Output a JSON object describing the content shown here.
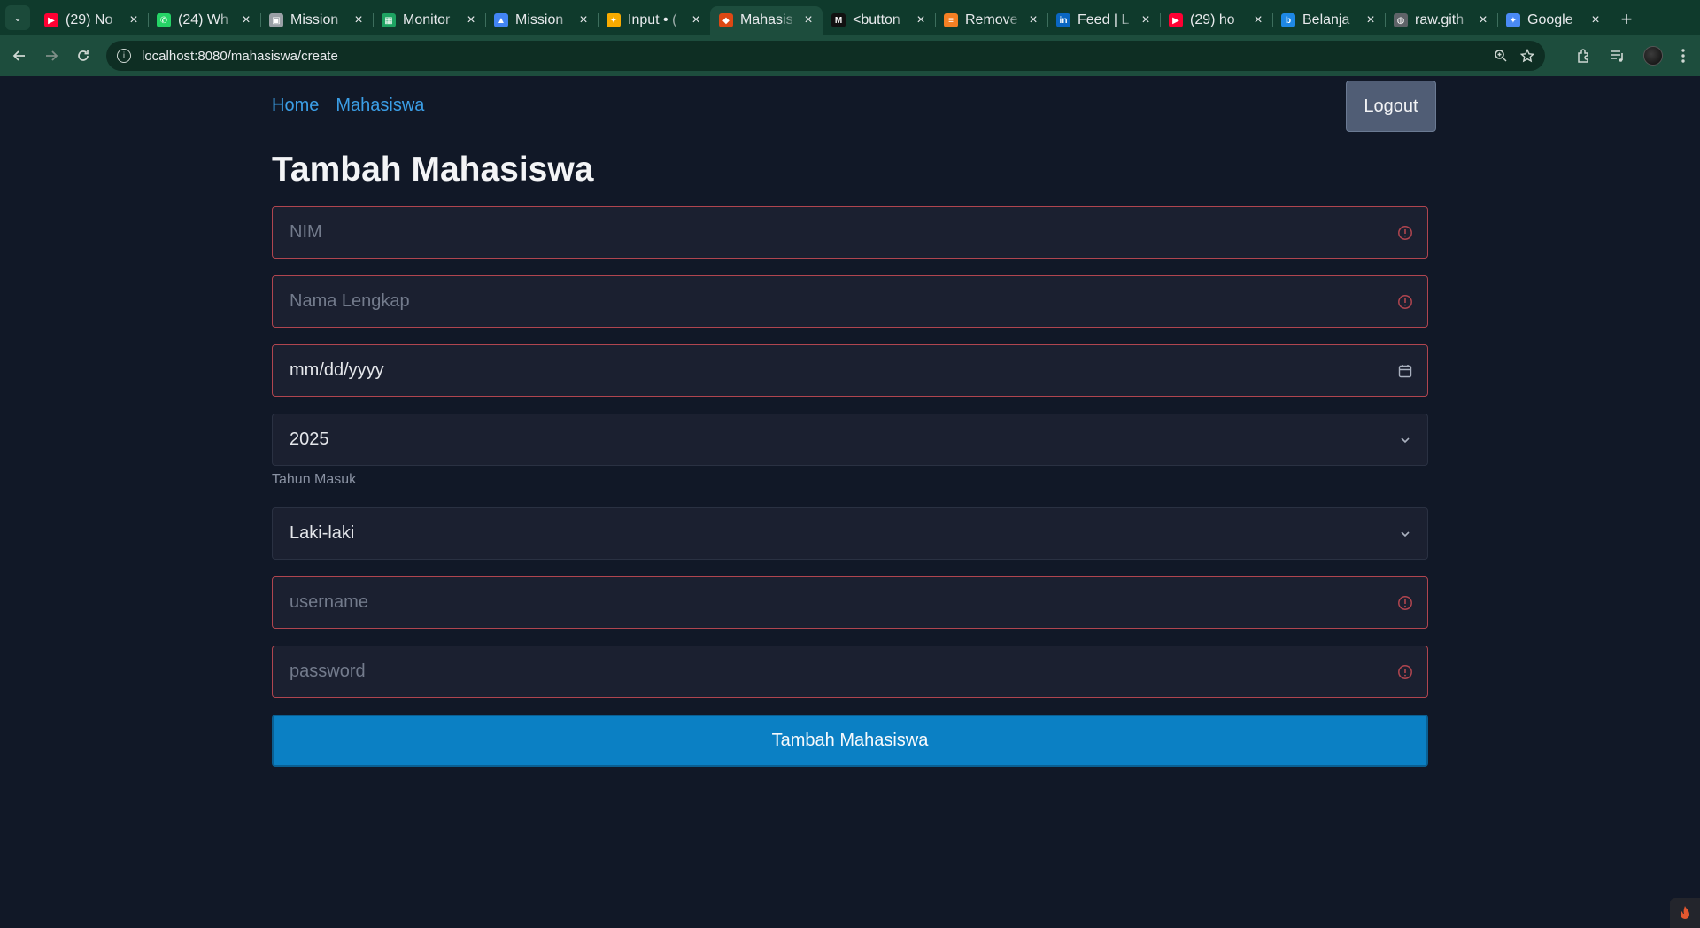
{
  "browser": {
    "tabs": [
      {
        "title": "(29) No",
        "favicon": "youtube-icon",
        "color": "#ff0033",
        "glyph": "▶"
      },
      {
        "title": "(24) Wh",
        "favicon": "whatsapp-icon",
        "color": "#25d366",
        "glyph": "✆"
      },
      {
        "title": "Mission",
        "favicon": "contact-card-icon",
        "color": "#9aa0a6",
        "glyph": "▣"
      },
      {
        "title": "Monitor",
        "favicon": "sheets-icon",
        "color": "#1ea362",
        "glyph": "▦"
      },
      {
        "title": "Mission",
        "favicon": "drive-icon",
        "color": "#4285f4",
        "glyph": "▲"
      },
      {
        "title": "Input • (",
        "favicon": "sparkle-icon",
        "color": "#f9ab00",
        "glyph": "✦"
      },
      {
        "title": "Mahasis",
        "favicon": "codeigniter-icon",
        "color": "#dd4814",
        "glyph": "◆"
      },
      {
        "title": "<button",
        "favicon": "m-icon",
        "color": "#111111",
        "glyph": "M"
      },
      {
        "title": "Remove",
        "favicon": "stackoverflow-icon",
        "color": "#f48024",
        "glyph": "≡"
      },
      {
        "title": "Feed | L",
        "favicon": "linkedin-icon",
        "color": "#0a66c2",
        "glyph": "in"
      },
      {
        "title": "(29) ho",
        "favicon": "youtube-icon",
        "color": "#ff0033",
        "glyph": "▶"
      },
      {
        "title": "Belanja",
        "favicon": "shop-icon",
        "color": "#1e88e5",
        "glyph": "b"
      },
      {
        "title": "raw.gith",
        "favicon": "globe-icon",
        "color": "#5f6368",
        "glyph": "◍"
      },
      {
        "title": "Google",
        "favicon": "gemini-icon",
        "color": "#4a8af4",
        "glyph": "✦"
      }
    ],
    "active_tab": 6,
    "url": "localhost:8080/mahasiswa/create"
  },
  "nav": {
    "home": "Home",
    "mahasiswa": "Mahasiswa",
    "logout": "Logout"
  },
  "page": {
    "title": "Tambah Mahasiswa"
  },
  "form": {
    "nim_placeholder": "NIM",
    "nama_placeholder": "Nama Lengkap",
    "tanggal_placeholder": "mm/dd/yyyy",
    "tahun_value": "2025",
    "tahun_helper": "Tahun Masuk",
    "gender_value": "Laki-laki",
    "username_placeholder": "username",
    "password_placeholder": "password",
    "submit_label": "Tambah Mahasiswa"
  },
  "colors": {
    "background": "#111827",
    "link": "#3b9ee6",
    "invalid_border": "#b0454f",
    "submit": "#0b80c4"
  }
}
